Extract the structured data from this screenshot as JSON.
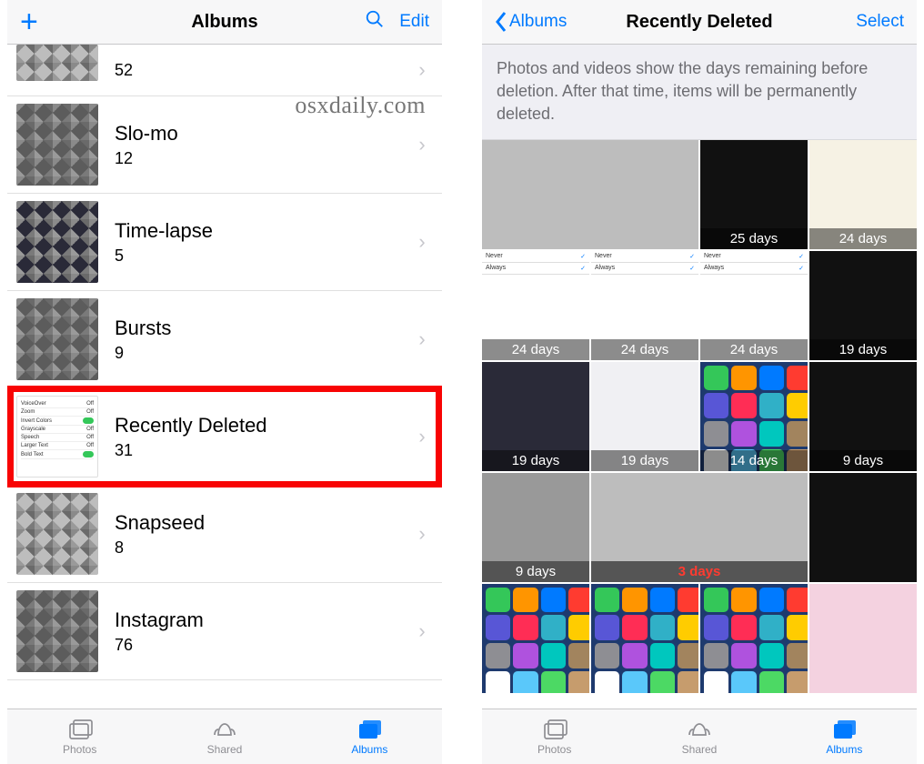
{
  "watermark": "osxdaily.com",
  "left": {
    "header": {
      "title": "Albums",
      "edit": "Edit"
    },
    "albums": [
      {
        "name": "",
        "count": "52",
        "thumb": "px l",
        "partial": true
      },
      {
        "name": "Slo-mo",
        "count": "12",
        "thumb": "px"
      },
      {
        "name": "Time-lapse",
        "count": "5",
        "thumb": "px d"
      },
      {
        "name": "Bursts",
        "count": "9",
        "thumb": "px"
      },
      {
        "name": "Recently Deleted",
        "count": "31",
        "thumb": "settings",
        "highlighted": true
      },
      {
        "name": "Snapseed",
        "count": "8",
        "thumb": "px l"
      },
      {
        "name": "Instagram",
        "count": "76",
        "thumb": "px"
      }
    ],
    "tabs": {
      "photos": "Photos",
      "shared": "Shared",
      "albums": "Albums",
      "active": "albums"
    }
  },
  "right": {
    "header": {
      "back": "Albums",
      "title": "Recently Deleted",
      "select": "Select"
    },
    "info": "Photos and videos show the days remaining before deletion. After that time, items will be permanently deleted.",
    "grid": [
      {
        "span": 2,
        "style": "px l",
        "label": ""
      },
      {
        "span": 1,
        "style": "dark",
        "label": "25 days"
      },
      {
        "span": 1,
        "style": "cream",
        "label": "24 days"
      },
      {
        "span": 1,
        "style": "seg",
        "label": "24 days"
      },
      {
        "span": 1,
        "style": "seg",
        "label": "24 days"
      },
      {
        "span": 1,
        "style": "seg",
        "label": "24 days"
      },
      {
        "span": 1,
        "style": "dark",
        "label": "19 days"
      },
      {
        "span": 1,
        "style": "px d",
        "label": "19 days"
      },
      {
        "span": 1,
        "style": "light",
        "label": "19 days"
      },
      {
        "span": 1,
        "style": "appicons",
        "label": "14 days"
      },
      {
        "span": 1,
        "style": "dark",
        "label": "9 days"
      },
      {
        "span": 1,
        "style": "px",
        "label": "9 days"
      },
      {
        "span": 2,
        "style": "px l",
        "label": "3 days",
        "red": true
      },
      {
        "span": 1,
        "style": "dark",
        "label": ""
      },
      {
        "span": 1,
        "style": "appicons",
        "label": ""
      },
      {
        "span": 1,
        "style": "appicons",
        "label": ""
      },
      {
        "span": 1,
        "style": "appicons",
        "label": ""
      },
      {
        "span": 1,
        "style": "pink",
        "label": ""
      }
    ],
    "tabs": {
      "photos": "Photos",
      "shared": "Shared",
      "albums": "Albums",
      "active": "albums"
    }
  }
}
